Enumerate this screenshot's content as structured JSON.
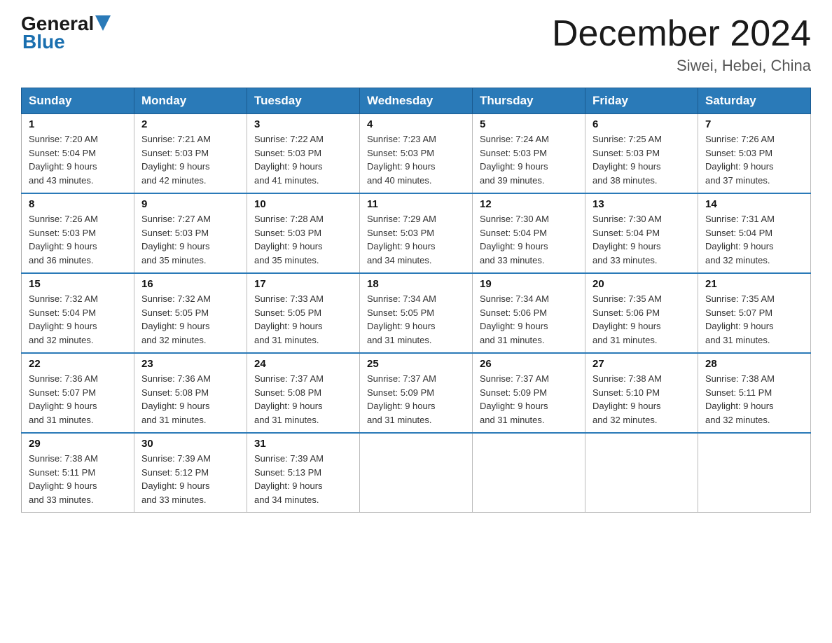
{
  "logo": {
    "text_general": "General",
    "text_blue": "Blue"
  },
  "header": {
    "title": "December 2024",
    "location": "Siwei, Hebei, China"
  },
  "days_of_week": [
    "Sunday",
    "Monday",
    "Tuesday",
    "Wednesday",
    "Thursday",
    "Friday",
    "Saturday"
  ],
  "weeks": [
    [
      {
        "day": "1",
        "sunrise": "7:20 AM",
        "sunset": "5:04 PM",
        "daylight": "9 hours and 43 minutes."
      },
      {
        "day": "2",
        "sunrise": "7:21 AM",
        "sunset": "5:03 PM",
        "daylight": "9 hours and 42 minutes."
      },
      {
        "day": "3",
        "sunrise": "7:22 AM",
        "sunset": "5:03 PM",
        "daylight": "9 hours and 41 minutes."
      },
      {
        "day": "4",
        "sunrise": "7:23 AM",
        "sunset": "5:03 PM",
        "daylight": "9 hours and 40 minutes."
      },
      {
        "day": "5",
        "sunrise": "7:24 AM",
        "sunset": "5:03 PM",
        "daylight": "9 hours and 39 minutes."
      },
      {
        "day": "6",
        "sunrise": "7:25 AM",
        "sunset": "5:03 PM",
        "daylight": "9 hours and 38 minutes."
      },
      {
        "day": "7",
        "sunrise": "7:26 AM",
        "sunset": "5:03 PM",
        "daylight": "9 hours and 37 minutes."
      }
    ],
    [
      {
        "day": "8",
        "sunrise": "7:26 AM",
        "sunset": "5:03 PM",
        "daylight": "9 hours and 36 minutes."
      },
      {
        "day": "9",
        "sunrise": "7:27 AM",
        "sunset": "5:03 PM",
        "daylight": "9 hours and 35 minutes."
      },
      {
        "day": "10",
        "sunrise": "7:28 AM",
        "sunset": "5:03 PM",
        "daylight": "9 hours and 35 minutes."
      },
      {
        "day": "11",
        "sunrise": "7:29 AM",
        "sunset": "5:03 PM",
        "daylight": "9 hours and 34 minutes."
      },
      {
        "day": "12",
        "sunrise": "7:30 AM",
        "sunset": "5:04 PM",
        "daylight": "9 hours and 33 minutes."
      },
      {
        "day": "13",
        "sunrise": "7:30 AM",
        "sunset": "5:04 PM",
        "daylight": "9 hours and 33 minutes."
      },
      {
        "day": "14",
        "sunrise": "7:31 AM",
        "sunset": "5:04 PM",
        "daylight": "9 hours and 32 minutes."
      }
    ],
    [
      {
        "day": "15",
        "sunrise": "7:32 AM",
        "sunset": "5:04 PM",
        "daylight": "9 hours and 32 minutes."
      },
      {
        "day": "16",
        "sunrise": "7:32 AM",
        "sunset": "5:05 PM",
        "daylight": "9 hours and 32 minutes."
      },
      {
        "day": "17",
        "sunrise": "7:33 AM",
        "sunset": "5:05 PM",
        "daylight": "9 hours and 31 minutes."
      },
      {
        "day": "18",
        "sunrise": "7:34 AM",
        "sunset": "5:05 PM",
        "daylight": "9 hours and 31 minutes."
      },
      {
        "day": "19",
        "sunrise": "7:34 AM",
        "sunset": "5:06 PM",
        "daylight": "9 hours and 31 minutes."
      },
      {
        "day": "20",
        "sunrise": "7:35 AM",
        "sunset": "5:06 PM",
        "daylight": "9 hours and 31 minutes."
      },
      {
        "day": "21",
        "sunrise": "7:35 AM",
        "sunset": "5:07 PM",
        "daylight": "9 hours and 31 minutes."
      }
    ],
    [
      {
        "day": "22",
        "sunrise": "7:36 AM",
        "sunset": "5:07 PM",
        "daylight": "9 hours and 31 minutes."
      },
      {
        "day": "23",
        "sunrise": "7:36 AM",
        "sunset": "5:08 PM",
        "daylight": "9 hours and 31 minutes."
      },
      {
        "day": "24",
        "sunrise": "7:37 AM",
        "sunset": "5:08 PM",
        "daylight": "9 hours and 31 minutes."
      },
      {
        "day": "25",
        "sunrise": "7:37 AM",
        "sunset": "5:09 PM",
        "daylight": "9 hours and 31 minutes."
      },
      {
        "day": "26",
        "sunrise": "7:37 AM",
        "sunset": "5:09 PM",
        "daylight": "9 hours and 31 minutes."
      },
      {
        "day": "27",
        "sunrise": "7:38 AM",
        "sunset": "5:10 PM",
        "daylight": "9 hours and 32 minutes."
      },
      {
        "day": "28",
        "sunrise": "7:38 AM",
        "sunset": "5:11 PM",
        "daylight": "9 hours and 32 minutes."
      }
    ],
    [
      {
        "day": "29",
        "sunrise": "7:38 AM",
        "sunset": "5:11 PM",
        "daylight": "9 hours and 33 minutes."
      },
      {
        "day": "30",
        "sunrise": "7:39 AM",
        "sunset": "5:12 PM",
        "daylight": "9 hours and 33 minutes."
      },
      {
        "day": "31",
        "sunrise": "7:39 AM",
        "sunset": "5:13 PM",
        "daylight": "9 hours and 34 minutes."
      },
      null,
      null,
      null,
      null
    ]
  ],
  "labels": {
    "sunrise": "Sunrise:",
    "sunset": "Sunset:",
    "daylight": "Daylight:"
  }
}
